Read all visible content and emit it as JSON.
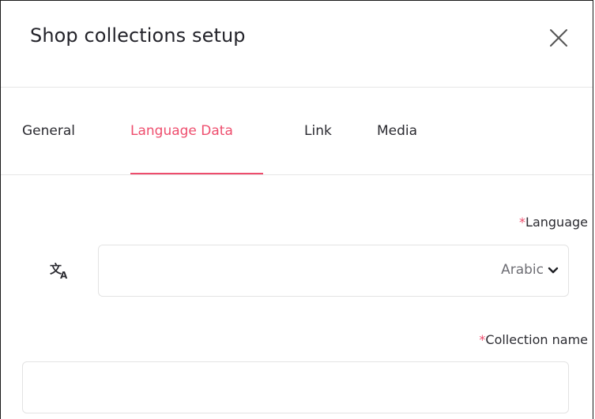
{
  "dialog": {
    "title": "Shop collections setup",
    "close_icon": "close-icon"
  },
  "tabs": [
    {
      "label": "General",
      "active": false
    },
    {
      "label": "Language Data",
      "active": true
    },
    {
      "label": "Link",
      "active": false
    },
    {
      "label": "Media",
      "active": false
    }
  ],
  "form": {
    "language": {
      "required_mark": "*",
      "label": "Language",
      "icon": "translate-icon",
      "value": "Arabic",
      "chevron_icon": "chevron-down-icon"
    },
    "collection_name": {
      "required_mark": "*",
      "label": "Collection name",
      "value": ""
    }
  },
  "colors": {
    "accent": "#ee4d6d",
    "text": "#23232a",
    "border": "#e3e3e3"
  }
}
